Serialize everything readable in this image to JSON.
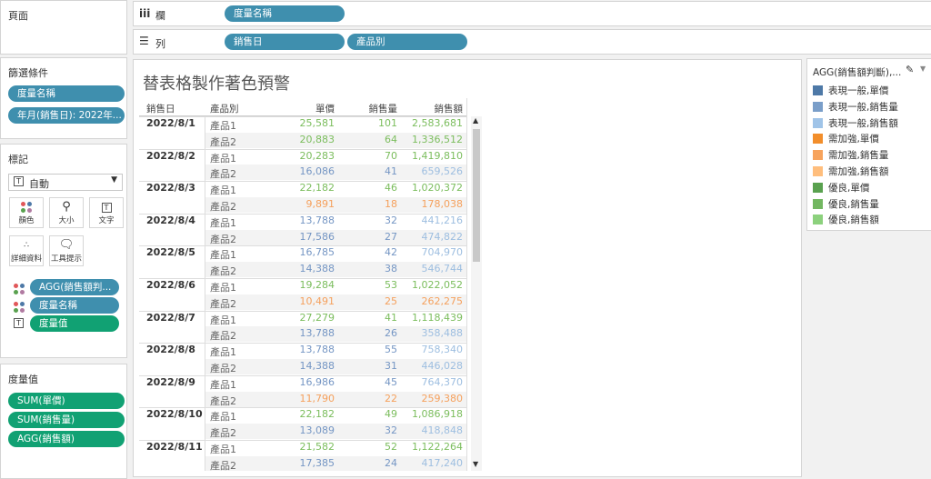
{
  "pages_card": {
    "title": "頁面"
  },
  "filters_card": {
    "title": "篩選條件",
    "items": [
      "度量名稱",
      "年月(銷售日): 2022年..."
    ]
  },
  "marks_card": {
    "title": "標記",
    "mark_type": "自動",
    "buttons": [
      {
        "label": "顏色",
        "icon": "color-icon"
      },
      {
        "label": "大小",
        "icon": "size-icon"
      },
      {
        "label": "文字",
        "icon": "text-icon"
      },
      {
        "label": "詳細資料",
        "icon": "detail-icon"
      },
      {
        "label": "工具提示",
        "icon": "tooltip-icon"
      }
    ],
    "fields": [
      {
        "icon": "color-icon",
        "label": "AGG(銷售額判..."
      },
      {
        "icon": "color-icon",
        "label": "度量名稱"
      },
      {
        "icon": "text-icon",
        "label": "度量值"
      }
    ]
  },
  "measure_values_card": {
    "title": "度量值",
    "items": [
      "SUM(單價)",
      "SUM(銷售量)",
      "AGG(銷售額)"
    ]
  },
  "shelves": {
    "columns": {
      "icon": "iii",
      "label": "欄",
      "pill": "度量名稱"
    },
    "rows": {
      "icon": "☰",
      "label": "列",
      "pills": [
        "銷售日",
        "產品別"
      ]
    }
  },
  "sheet": {
    "title": "替表格製作著色預警",
    "headers": {
      "date": "銷售日",
      "product": "產品別",
      "price": "單價",
      "qty": "銷售量",
      "amount": "銷售額"
    },
    "colors": {
      "blue": "#7596c4",
      "green": "#7bbd5d",
      "orange": "#f5a05c",
      "blue_light": "#9dbee0",
      "green_dark": "#4e9a3e"
    },
    "rows": [
      {
        "date": "2022/8/1",
        "product": "產品1",
        "price": "25,581",
        "qty": "101",
        "amount": "2,583,681",
        "c": [
          "green",
          "green",
          "green"
        ]
      },
      {
        "date": "",
        "product": "產品2",
        "price": "20,883",
        "qty": "64",
        "amount": "1,336,512",
        "c": [
          "green",
          "green",
          "green"
        ]
      },
      {
        "date": "2022/8/2",
        "product": "產品1",
        "price": "20,283",
        "qty": "70",
        "amount": "1,419,810",
        "c": [
          "green",
          "green",
          "green"
        ]
      },
      {
        "date": "",
        "product": "產品2",
        "price": "16,086",
        "qty": "41",
        "amount": "659,526",
        "c": [
          "blue",
          "blue",
          "blue_light"
        ]
      },
      {
        "date": "2022/8/3",
        "product": "產品1",
        "price": "22,182",
        "qty": "46",
        "amount": "1,020,372",
        "c": [
          "green",
          "green",
          "green"
        ]
      },
      {
        "date": "",
        "product": "產品2",
        "price": "9,891",
        "qty": "18",
        "amount": "178,038",
        "c": [
          "orange",
          "orange",
          "orange"
        ]
      },
      {
        "date": "2022/8/4",
        "product": "產品1",
        "price": "13,788",
        "qty": "32",
        "amount": "441,216",
        "c": [
          "blue",
          "blue",
          "blue_light"
        ]
      },
      {
        "date": "",
        "product": "產品2",
        "price": "17,586",
        "qty": "27",
        "amount": "474,822",
        "c": [
          "blue",
          "blue",
          "blue_light"
        ]
      },
      {
        "date": "2022/8/5",
        "product": "產品1",
        "price": "16,785",
        "qty": "42",
        "amount": "704,970",
        "c": [
          "blue",
          "blue",
          "blue_light"
        ]
      },
      {
        "date": "",
        "product": "產品2",
        "price": "14,388",
        "qty": "38",
        "amount": "546,744",
        "c": [
          "blue",
          "blue",
          "blue_light"
        ]
      },
      {
        "date": "2022/8/6",
        "product": "產品1",
        "price": "19,284",
        "qty": "53",
        "amount": "1,022,052",
        "c": [
          "green",
          "green",
          "green"
        ]
      },
      {
        "date": "",
        "product": "產品2",
        "price": "10,491",
        "qty": "25",
        "amount": "262,275",
        "c": [
          "orange",
          "orange",
          "orange"
        ]
      },
      {
        "date": "2022/8/7",
        "product": "產品1",
        "price": "27,279",
        "qty": "41",
        "amount": "1,118,439",
        "c": [
          "green",
          "green",
          "green"
        ]
      },
      {
        "date": "",
        "product": "產品2",
        "price": "13,788",
        "qty": "26",
        "amount": "358,488",
        "c": [
          "blue",
          "blue",
          "blue_light"
        ]
      },
      {
        "date": "2022/8/8",
        "product": "產品1",
        "price": "13,788",
        "qty": "55",
        "amount": "758,340",
        "c": [
          "blue",
          "blue",
          "blue_light"
        ]
      },
      {
        "date": "",
        "product": "產品2",
        "price": "14,388",
        "qty": "31",
        "amount": "446,028",
        "c": [
          "blue",
          "blue",
          "blue_light"
        ]
      },
      {
        "date": "2022/8/9",
        "product": "產品1",
        "price": "16,986",
        "qty": "45",
        "amount": "764,370",
        "c": [
          "blue",
          "blue",
          "blue_light"
        ]
      },
      {
        "date": "",
        "product": "產品2",
        "price": "11,790",
        "qty": "22",
        "amount": "259,380",
        "c": [
          "orange",
          "orange",
          "orange"
        ]
      },
      {
        "date": "2022/8/10",
        "product": "產品1",
        "price": "22,182",
        "qty": "49",
        "amount": "1,086,918",
        "c": [
          "green",
          "green",
          "green"
        ]
      },
      {
        "date": "",
        "product": "產品2",
        "price": "13,089",
        "qty": "32",
        "amount": "418,848",
        "c": [
          "blue",
          "blue",
          "blue_light"
        ]
      },
      {
        "date": "2022/8/11",
        "product": "產品1",
        "price": "21,582",
        "qty": "52",
        "amount": "1,122,264",
        "c": [
          "green",
          "green",
          "green"
        ]
      },
      {
        "date": "",
        "product": "產品2",
        "price": "17,385",
        "qty": "24",
        "amount": "417,240",
        "c": [
          "blue",
          "blue",
          "blue_light"
        ]
      }
    ]
  },
  "legend": {
    "title": "AGG(銷售額判斷),...",
    "items": [
      {
        "label": "表現一般,單價",
        "color": "#4e79a7"
      },
      {
        "label": "表現一般,銷售量",
        "color": "#7a9ec9"
      },
      {
        "label": "表現一般,銷售額",
        "color": "#a0c4e8"
      },
      {
        "label": "需加強,單價",
        "color": "#f28e2b"
      },
      {
        "label": "需加強,銷售量",
        "color": "#f7a35c"
      },
      {
        "label": "需加強,銷售額",
        "color": "#ffbe7d"
      },
      {
        "label": "優良,單價",
        "color": "#59a14f"
      },
      {
        "label": "優良,銷售量",
        "color": "#73b761"
      },
      {
        "label": "優良,銷售額",
        "color": "#8cd17d"
      }
    ]
  }
}
